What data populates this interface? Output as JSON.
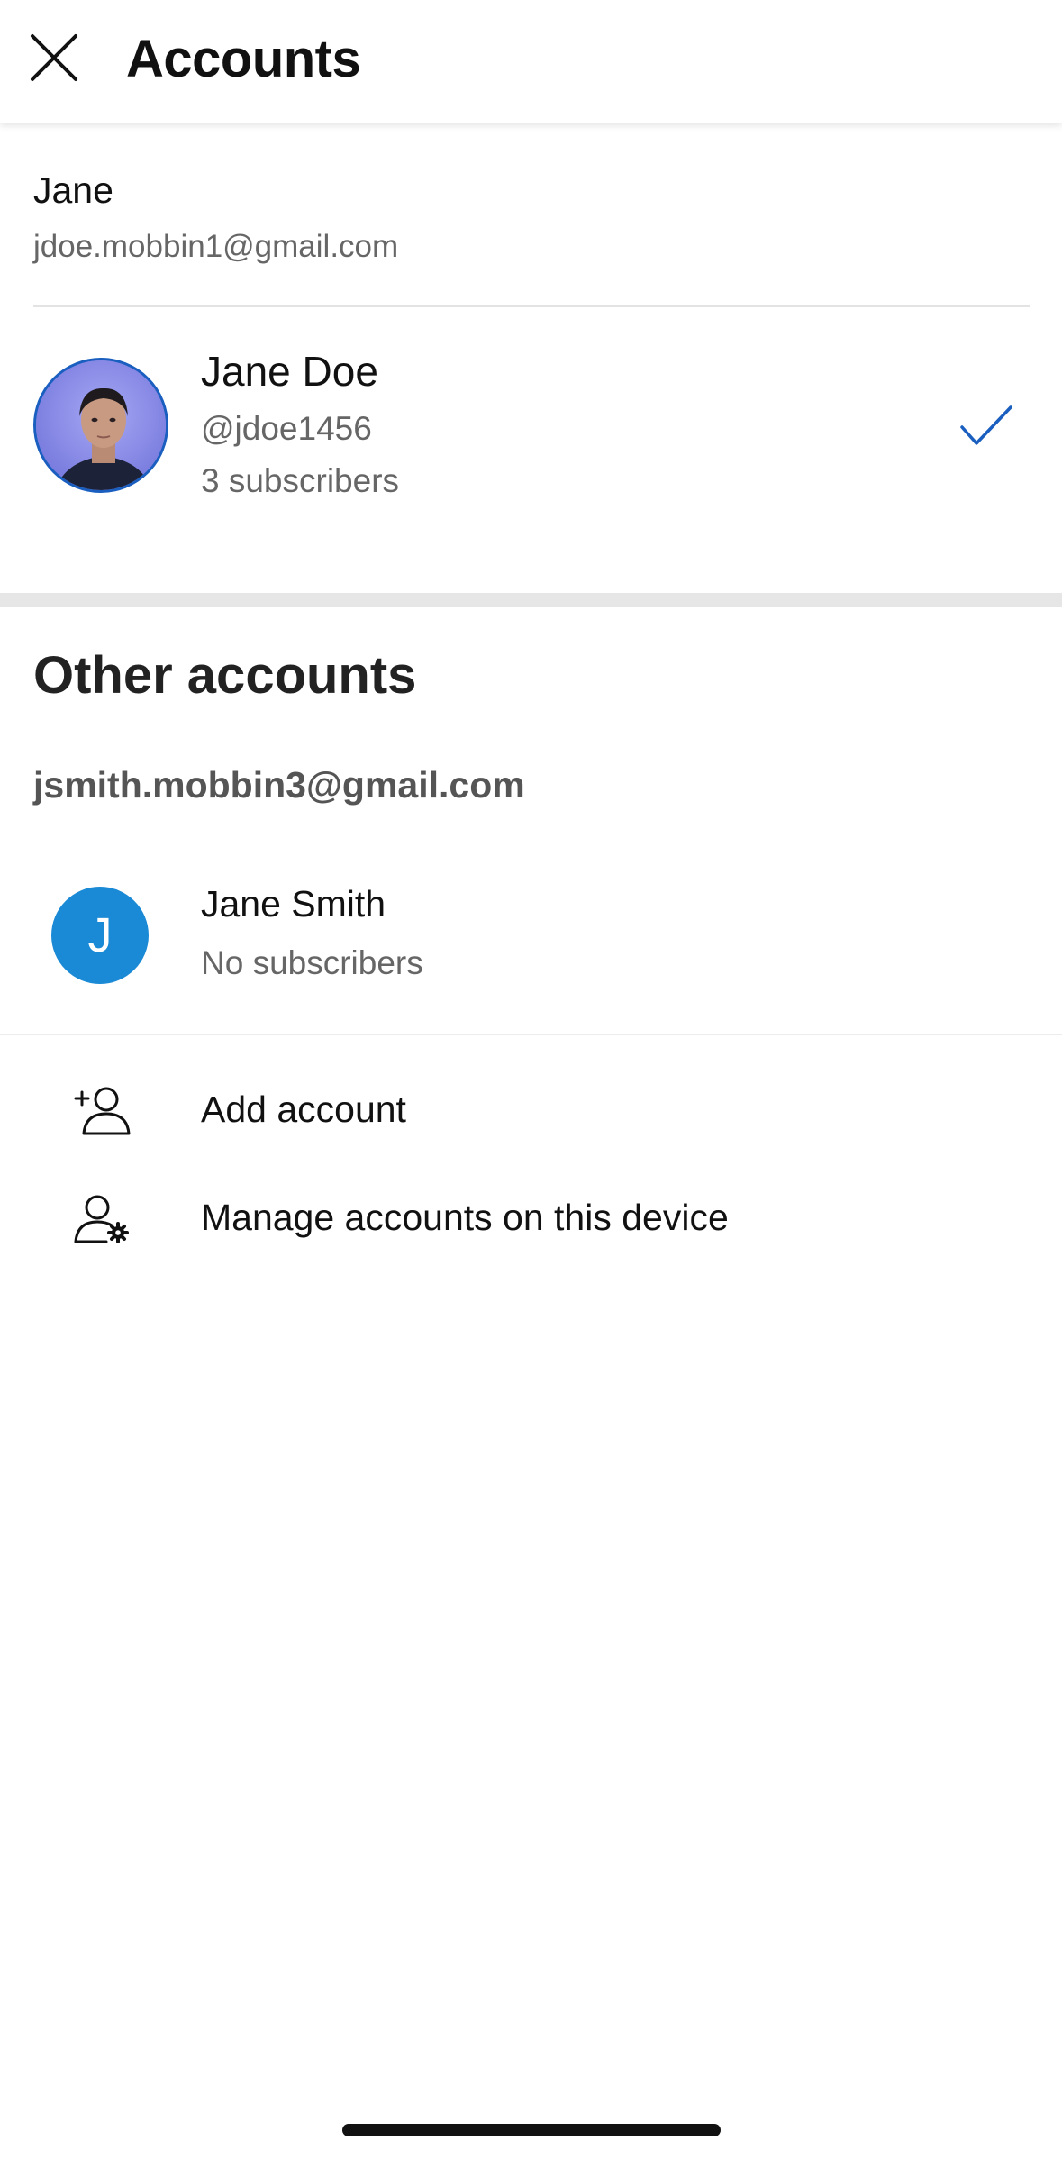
{
  "header": {
    "title": "Accounts",
    "close_icon": "close-icon"
  },
  "current_account": {
    "name": "Jane",
    "email": "jdoe.mobbin1@gmail.com",
    "channel": {
      "name": "Jane Doe",
      "handle": "@jdoe1456",
      "subscribers": "3 subscribers",
      "selected": true
    }
  },
  "other_accounts": {
    "heading": "Other accounts",
    "email": "jsmith.mobbin3@gmail.com",
    "channel": {
      "avatar_letter": "J",
      "name": "Jane Smith",
      "subscribers": "No subscribers"
    }
  },
  "actions": {
    "add_account": "Add account",
    "manage_accounts": "Manage accounts on this device"
  },
  "colors": {
    "accent": "#1a5fbf",
    "avatar_blue": "#1a8ad6",
    "separator": "#e6e6e6",
    "secondary_text": "#666666"
  }
}
